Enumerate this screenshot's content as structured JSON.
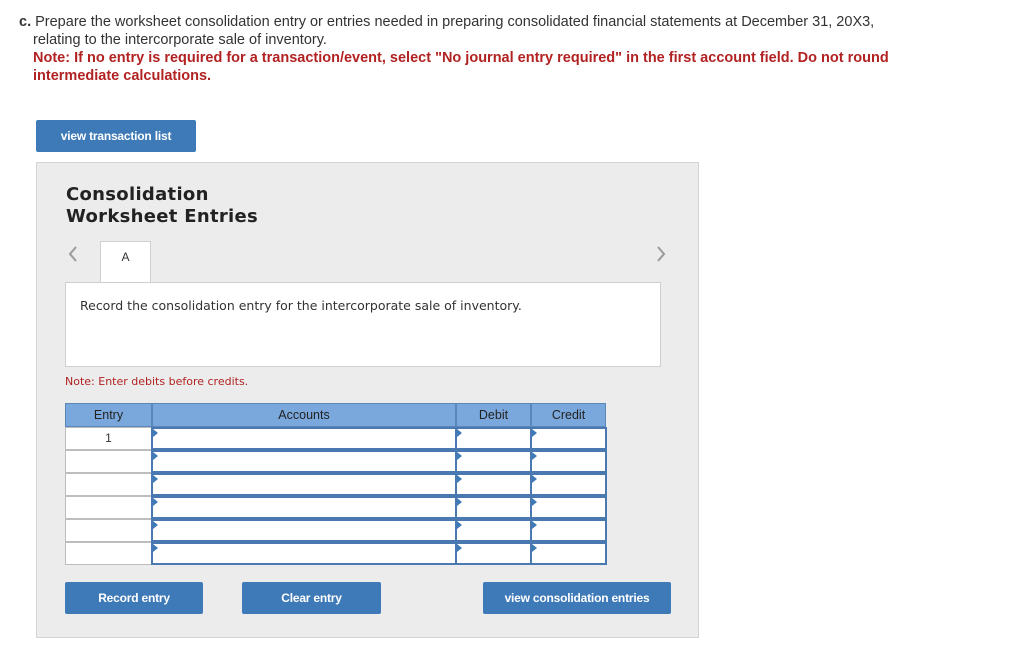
{
  "question": {
    "prefix": "c.",
    "line1": " Prepare the worksheet consolidation entry or entries needed in preparing consolidated financial statements at December 31, 20X3,",
    "line2": "relating to the intercorporate sale of inventory.",
    "note_line1": "Note: If no entry is required for a transaction/event, select \"No journal entry required\" in the first account field. Do not round",
    "note_line2": "intermediate calculations."
  },
  "buttons": {
    "view_transaction_list": "view transaction list",
    "record_entry": "Record entry",
    "clear_entry": "Clear entry",
    "view_consolidation_entries": "view consolidation entries"
  },
  "panel": {
    "title_line1": "Consolidation",
    "title_line2": "Worksheet Entries",
    "nav_prev": "<",
    "nav_next": ">",
    "tab_label": "A",
    "instruction": "Record the consolidation entry for the intercorporate sale of inventory.",
    "note": "Note: Enter debits before credits."
  },
  "table": {
    "headers": {
      "entry": "Entry",
      "accounts": "Accounts",
      "debit": "Debit",
      "credit": "Credit"
    },
    "rows": [
      {
        "entry": "1",
        "account": "",
        "debit": "",
        "credit": ""
      },
      {
        "entry": "",
        "account": "",
        "debit": "",
        "credit": ""
      },
      {
        "entry": "",
        "account": "",
        "debit": "",
        "credit": ""
      },
      {
        "entry": "",
        "account": "",
        "debit": "",
        "credit": ""
      },
      {
        "entry": "",
        "account": "",
        "debit": "",
        "credit": ""
      },
      {
        "entry": "",
        "account": "",
        "debit": "",
        "credit": ""
      }
    ]
  },
  "colors": {
    "accent": "#3e7ab8",
    "note_red": "#b22222",
    "header_blue": "#7ba8dc"
  }
}
